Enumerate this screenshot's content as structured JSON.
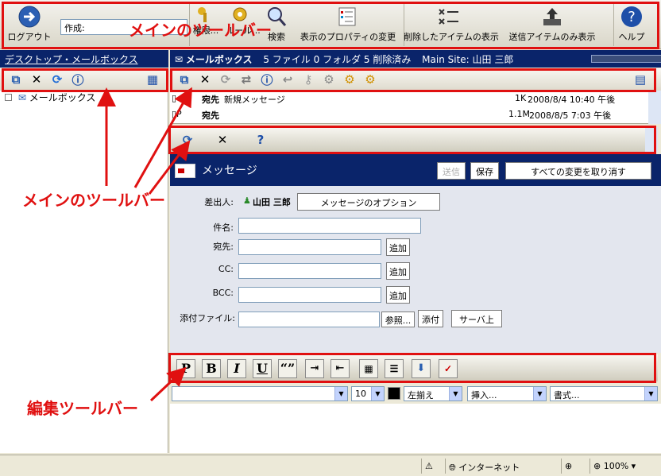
{
  "topbar": {
    "logout_label": "ログアウト",
    "compose_value": "作成:",
    "permissions_label": "権限...",
    "rules_label": "ルール...",
    "search_label": "検索",
    "view_props_label": "表示のプロパティの変更",
    "show_deleted_label": "削除したアイテムの表示",
    "sent_only_label": "送信アイテムのみ表示",
    "help_label": "ヘルプ"
  },
  "annotations": {
    "main_toolbar_top": "メインのツールバー",
    "main_toolbar_mid": "メインのツールバー",
    "edit_toolbar": "編集ツールバー"
  },
  "left": {
    "header": "デスクトップ・メールボックス",
    "tree_item": "メールボックス"
  },
  "mail": {
    "title": "メールボックス",
    "summary": "5 ファイル 0 フォルダ 5 削除済み",
    "site": "Main Site: 山田 三郎"
  },
  "messages": [
    {
      "to": "宛先",
      "subject": "新規メッセージ",
      "size": "1K",
      "date": "2008/8/4 10:40 午後"
    },
    {
      "to": "宛先",
      "subject": "",
      "size": "1.1M",
      "date": "2008/8/5 7:03 午後"
    }
  ],
  "compose": {
    "title": "メッセージ",
    "send_label": "送信",
    "save_label": "保存",
    "discard_label": "すべての変更を取り消す",
    "from_label": "差出人:",
    "from_name": "山田 三郎",
    "options_label": "メッセージのオプション",
    "subject_label": "件名:",
    "to_label": "宛先:",
    "cc_label": "CC:",
    "bcc_label": "BCC:",
    "add_label": "追加",
    "attach_label": "添付ファイル:",
    "browse_label": "参照...",
    "attach_btn": "添付",
    "server_btn": "サーバ上"
  },
  "editor": {
    "font_size": "10",
    "align": "左揃え",
    "insert": "挿入...",
    "format": "書式..."
  },
  "status": {
    "zone": "インターネット",
    "zoom": "100%"
  },
  "colors": {
    "annotation_red": "#e01010",
    "header_navy": "#0a246a"
  }
}
